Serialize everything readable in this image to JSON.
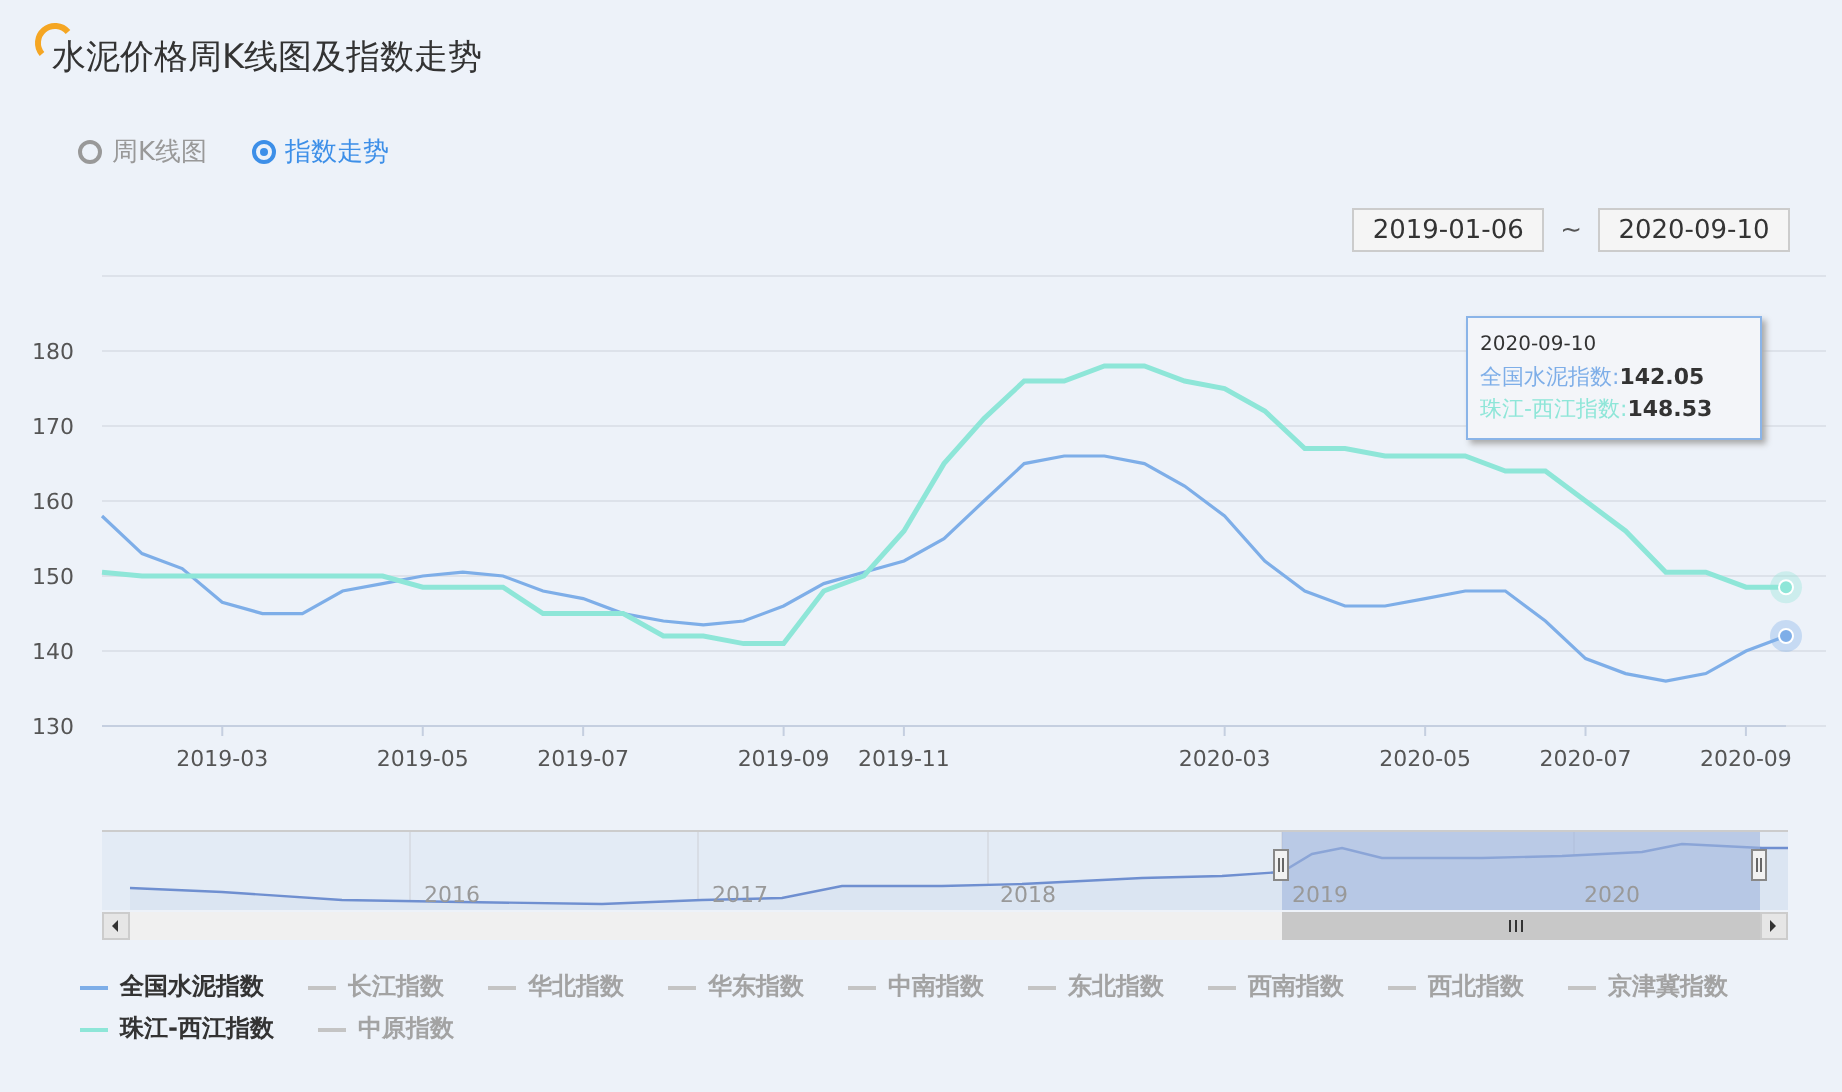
{
  "title": "水泥价格周K线图及指数走势",
  "view_options": [
    {
      "label": "周K线图",
      "selected": false
    },
    {
      "label": "指数走势",
      "selected": true
    }
  ],
  "date_range": {
    "start": "2019-01-06",
    "separator": "~",
    "end": "2020-09-10"
  },
  "chart": {
    "chart_data": {
      "type": "line",
      "grid": true,
      "ylim": [
        130,
        190
      ],
      "yticks": [
        130,
        140,
        150,
        160,
        170,
        180
      ],
      "categories": [
        null,
        null,
        null,
        "2019-03",
        null,
        null,
        null,
        null,
        "2019-05",
        null,
        null,
        null,
        "2019-07",
        null,
        null,
        null,
        null,
        "2019-09",
        null,
        null,
        "2019-11",
        null,
        null,
        null,
        null,
        null,
        null,
        null,
        "2020-03",
        null,
        null,
        null,
        null,
        "2020-05",
        null,
        null,
        null,
        "2020-07",
        null,
        null,
        null,
        "2020-09",
        null
      ],
      "series": [
        {
          "name": "全国水泥指数",
          "color": "#7eaee8",
          "values": [
            158,
            153,
            151,
            146.5,
            145,
            145,
            148,
            149,
            150,
            150.5,
            150,
            148,
            147,
            145,
            144,
            143.5,
            144,
            146,
            149,
            150.5,
            152,
            155,
            160,
            165,
            166,
            166,
            165,
            162,
            158,
            152,
            148,
            146,
            146,
            147,
            148,
            148,
            144,
            139,
            137,
            136,
            137,
            140,
            142
          ]
        },
        {
          "name": "珠江-西江指数",
          "color": "#8ee6d8",
          "values": [
            150.5,
            150,
            150,
            150,
            150,
            150,
            150,
            150,
            148.5,
            148.5,
            148.5,
            145,
            145,
            145,
            142,
            142,
            141,
            141,
            148,
            150,
            156,
            165,
            171,
            176,
            176,
            178,
            178,
            176,
            175,
            172,
            167,
            167,
            166,
            166,
            166,
            164,
            164,
            160,
            156,
            150.5,
            150.5,
            148.5,
            148.5
          ]
        }
      ]
    },
    "tooltip": {
      "date": "2020-09-10",
      "rows": [
        {
          "label": "全国水泥指数:",
          "value": "142.05",
          "color": "#7eaee8"
        },
        {
          "label": "珠江-西江指数:",
          "value": "148.53",
          "color": "#8ee6d8"
        }
      ]
    }
  },
  "navigator": {
    "years": [
      "2016",
      "2017",
      "2018",
      "2019",
      "2020"
    ]
  },
  "legend": [
    {
      "kind": "series",
      "on": true
    },
    {
      "label": "长江指数",
      "on": false
    },
    {
      "label": "华北指数",
      "on": false
    },
    {
      "label": "华东指数",
      "on": false
    },
    {
      "label": "中南指数",
      "on": false
    },
    {
      "label": "东北指数",
      "on": false
    },
    {
      "label": "西南指数",
      "on": false
    },
    {
      "label": "西北指数",
      "on": false
    },
    {
      "label": "京津冀指数",
      "on": false
    },
    {
      "kind": "series",
      "on": true
    },
    {
      "label": "中原指数",
      "on": false
    }
  ]
}
